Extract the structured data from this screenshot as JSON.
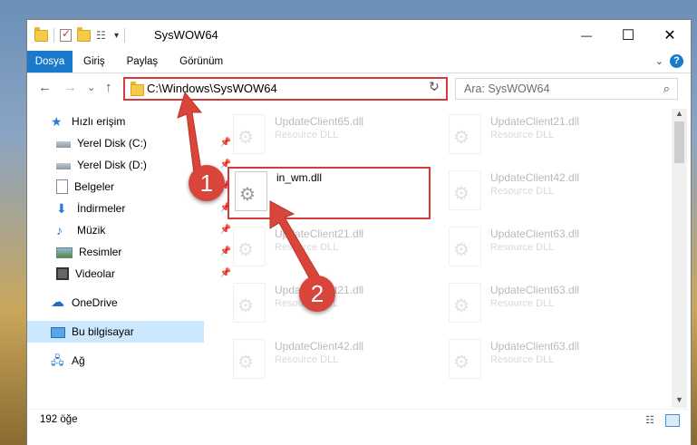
{
  "window": {
    "title": "SysWOW64",
    "minimize_glyph": "—",
    "maximize_glyph": "☐",
    "close_glyph": "✕"
  },
  "ribbon": {
    "tabs": [
      "Dosya",
      "Giriş",
      "Paylaş",
      "Görünüm"
    ],
    "help_glyph": "?"
  },
  "nav": {
    "back_glyph": "←",
    "forward_glyph": "→",
    "recent_glyph": "⌄",
    "up_glyph": "↑",
    "address": "C:\\Windows\\SysWOW64",
    "search_placeholder": "Ara: SysWOW64"
  },
  "sidebar": {
    "items": [
      {
        "label": "Hızlı erişim",
        "icon": "star-icon"
      },
      {
        "label": "Yerel Disk (C:)",
        "icon": "drive-icon"
      },
      {
        "label": "Yerel Disk (D:)",
        "icon": "drive-icon"
      },
      {
        "label": "Belgeler",
        "icon": "documents-icon"
      },
      {
        "label": "İndirmeler",
        "icon": "download-icon"
      },
      {
        "label": "Müzik",
        "icon": "music-icon"
      },
      {
        "label": "Resimler",
        "icon": "pictures-icon"
      },
      {
        "label": "Videolar",
        "icon": "video-icon"
      },
      {
        "label": "OneDrive",
        "icon": "cloud-icon"
      },
      {
        "label": "Bu bilgisayar",
        "icon": "computer-icon"
      },
      {
        "label": "Ağ",
        "icon": "network-icon"
      }
    ]
  },
  "files": [
    {
      "name": "UpdateClient65.dll",
      "type": "Resource DLL"
    },
    {
      "name": "UpdateClient21.dll",
      "type": "Resource DLL"
    },
    {
      "name": "in_wm.dll",
      "type": ""
    },
    {
      "name": "UpdateClient42.dll",
      "type": "Resource DLL"
    },
    {
      "name": "UpdateClient21.dll",
      "type": "Resource DLL"
    },
    {
      "name": "UpdateClient63.dll",
      "type": "Resource DLL"
    },
    {
      "name": "UpdateClient21.dll",
      "type": "Resource DLL"
    },
    {
      "name": "UpdateClient63.dll",
      "type": "Resource DLL"
    },
    {
      "name": "UpdateClient42.dll",
      "type": "Resource DLL"
    },
    {
      "name": "UpdateClient63.dll",
      "type": "Resource DLL"
    }
  ],
  "status": {
    "item_count": "192 öğe"
  },
  "callouts": {
    "step1": "1",
    "step2": "2"
  },
  "colors": {
    "accent": "#1979ca",
    "highlight_red": "#d43a3a",
    "badge_red": "#d9453a",
    "selected_bg": "#cce8ff"
  }
}
